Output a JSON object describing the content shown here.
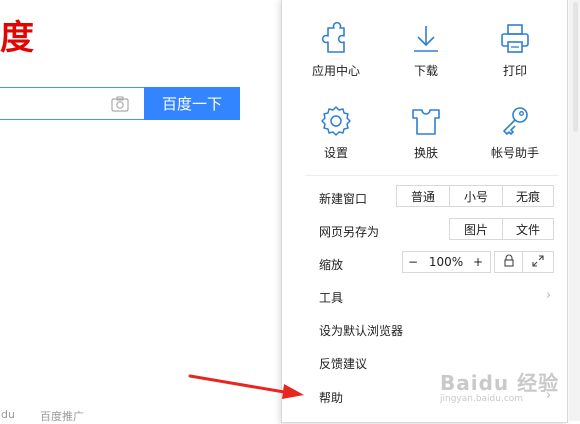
{
  "page": {
    "logo_fragment": "度",
    "search_button": "百度一下",
    "footer": [
      "idu",
      "百度推广"
    ]
  },
  "menu": {
    "tiles": [
      {
        "label": "应用中心",
        "icon": "puzzle-icon"
      },
      {
        "label": "下载",
        "icon": "download-icon"
      },
      {
        "label": "打印",
        "icon": "printer-icon"
      },
      {
        "label": "设置",
        "icon": "gear-icon"
      },
      {
        "label": "换肤",
        "icon": "shirt-icon"
      },
      {
        "label": "帐号助手",
        "icon": "key-icon"
      }
    ],
    "new_window": {
      "label": "新建窗口",
      "options": [
        "普通",
        "小号",
        "无痕"
      ]
    },
    "save_page": {
      "label": "网页另存为",
      "options": [
        "图片",
        "文件"
      ]
    },
    "zoom": {
      "label": "缩放",
      "minus": "−",
      "value": "100%",
      "plus": "+"
    },
    "tools": {
      "label": "工具"
    },
    "default_browser": {
      "label": "设为默认浏览器"
    },
    "feedback": {
      "label": "反馈建议"
    },
    "help": {
      "label": "帮助"
    }
  },
  "watermark": {
    "brand": "Baidu 经验",
    "url": "jingyan.baidu.com"
  },
  "colors": {
    "accent": "#3385ff",
    "logo_red": "#e10602",
    "icon_blue": "#2e7fd6",
    "arrow_red": "#e8251f"
  }
}
